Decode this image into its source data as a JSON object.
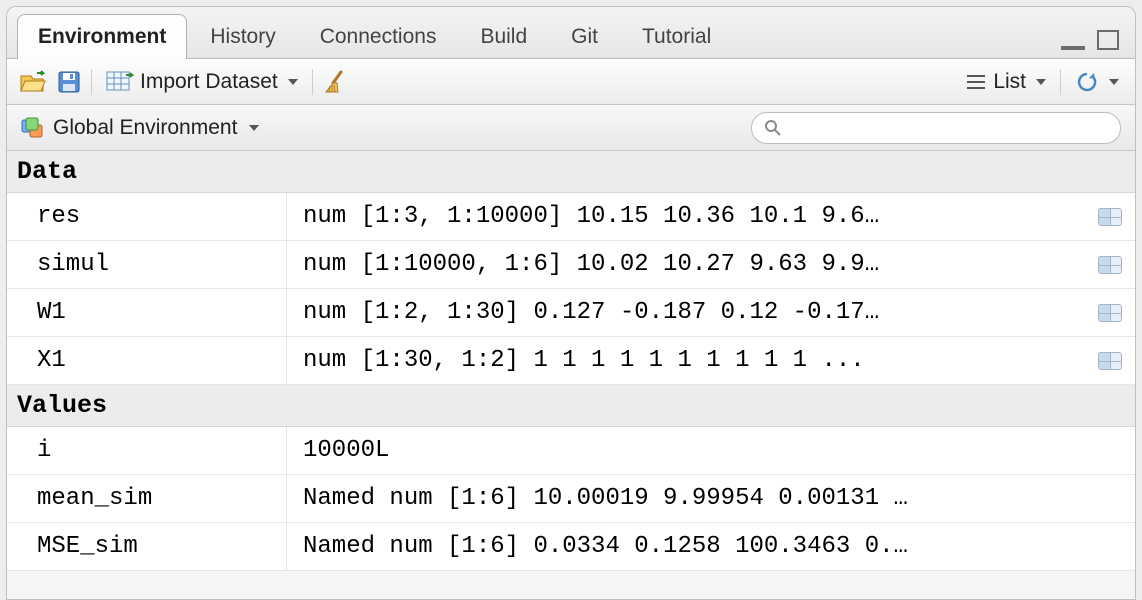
{
  "tabs": [
    {
      "label": "Environment",
      "active": true
    },
    {
      "label": "History",
      "active": false
    },
    {
      "label": "Connections",
      "active": false
    },
    {
      "label": "Build",
      "active": false
    },
    {
      "label": "Git",
      "active": false
    },
    {
      "label": "Tutorial",
      "active": false
    }
  ],
  "toolbar": {
    "import_label": "Import Dataset",
    "list_label": "List"
  },
  "scope": {
    "label": "Global Environment"
  },
  "search": {
    "placeholder": "",
    "value": ""
  },
  "sections": {
    "data": {
      "title": "Data",
      "items": [
        {
          "name": "res",
          "value": "num [1:3, 1:10000] 10.15 10.36 10.1 9.6…",
          "grid": true
        },
        {
          "name": "simul",
          "value": "num [1:10000, 1:6] 10.02 10.27 9.63 9.9…",
          "grid": true
        },
        {
          "name": "W1",
          "value": "num [1:2, 1:30] 0.127 -0.187 0.12 -0.17…",
          "grid": true
        },
        {
          "name": "X1",
          "value": "num [1:30, 1:2] 1 1 1 1 1 1 1 1 1 1 ...",
          "grid": true
        }
      ]
    },
    "values": {
      "title": "Values",
      "items": [
        {
          "name": "i",
          "value": "10000L"
        },
        {
          "name": "mean_sim",
          "value": "Named num [1:6] 10.00019 9.99954 0.00131 …"
        },
        {
          "name": "MSE_sim",
          "value": "Named num [1:6] 0.0334 0.1258 100.3463 0.…"
        }
      ]
    }
  }
}
